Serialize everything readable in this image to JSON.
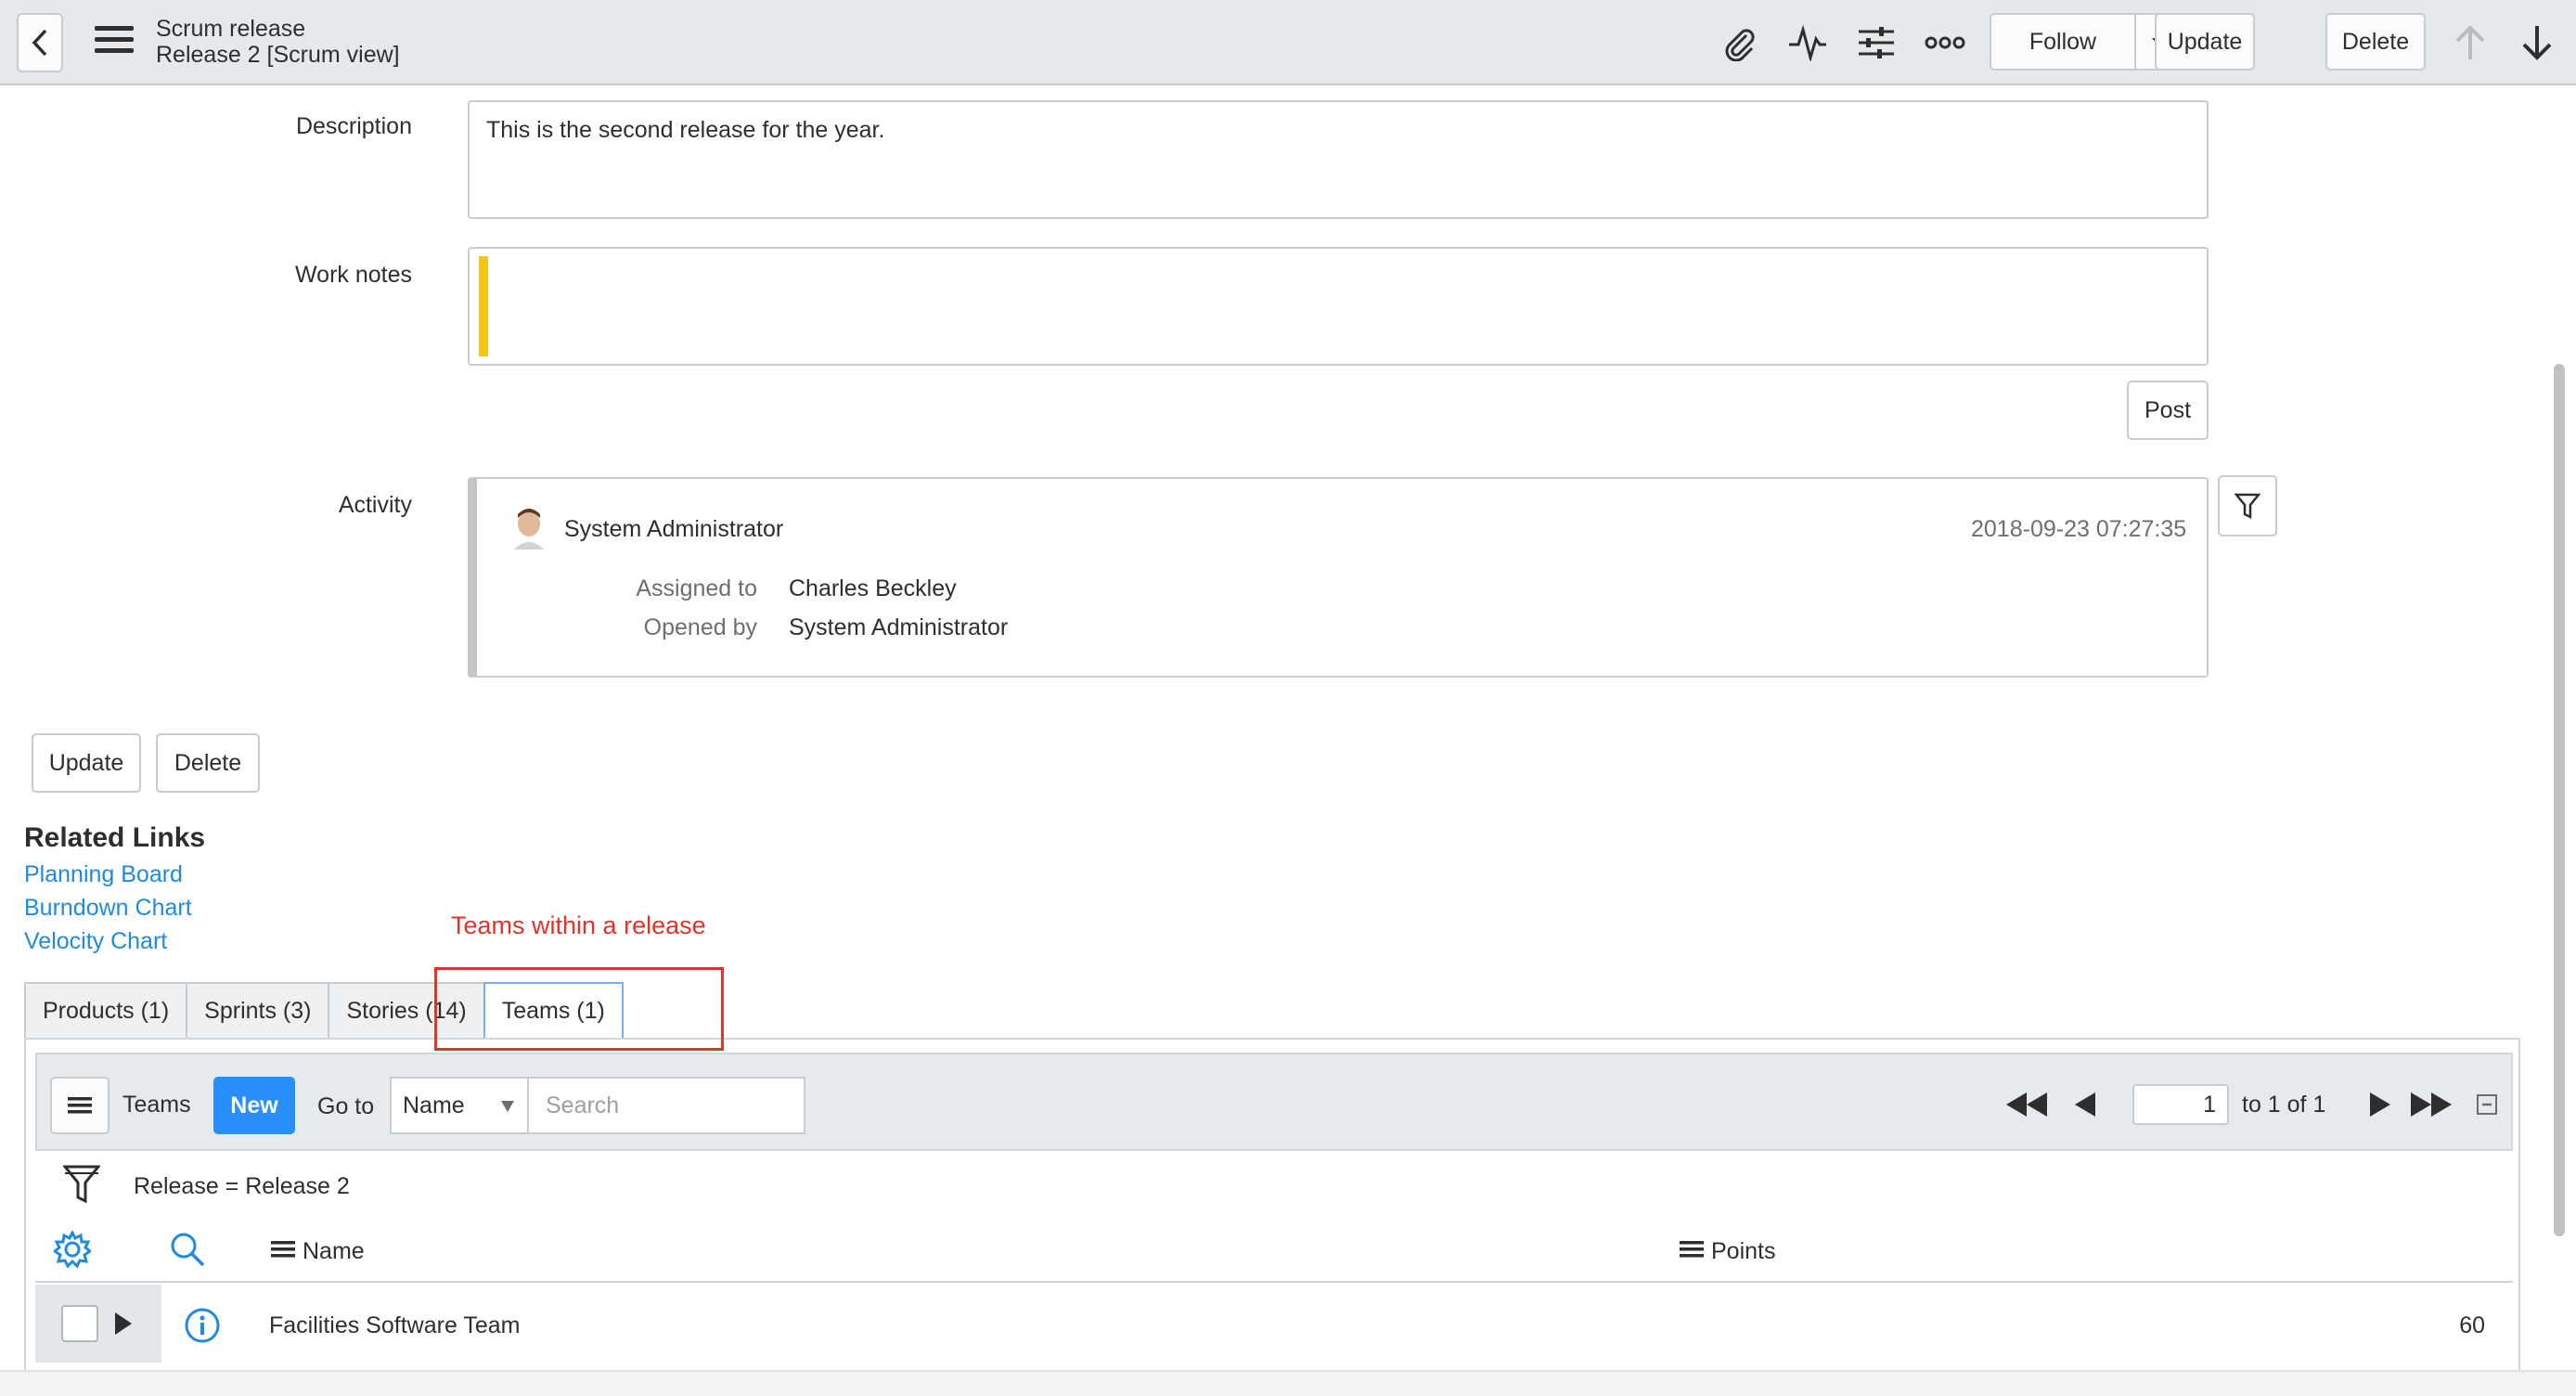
{
  "header": {
    "title": "Scrum release",
    "subtitle": "Release 2 [Scrum view]",
    "follow_label": "Follow",
    "update_label": "Update",
    "delete_label": "Delete"
  },
  "form": {
    "description_label": "Description",
    "description_value": "This is the second release for the year.",
    "work_notes_label": "Work notes",
    "post_label": "Post",
    "activity_label": "Activity"
  },
  "activity": {
    "user": "System Administrator",
    "timestamp": "2018-09-23 07:27:35",
    "fields": [
      {
        "label": "Assigned to",
        "value": "Charles Beckley"
      },
      {
        "label": "Opened by",
        "value": "System Administrator"
      }
    ]
  },
  "actions": {
    "update_label": "Update",
    "delete_label": "Delete"
  },
  "related_links": {
    "title": "Related Links",
    "links": [
      "Planning Board",
      "Burndown Chart",
      "Velocity Chart"
    ]
  },
  "annotation": "Teams within a release",
  "tabs": [
    "Products (1)",
    "Sprints (3)",
    "Stories (14)",
    "Teams (1)"
  ],
  "list": {
    "title": "Teams",
    "new_label": "New",
    "goto_label": "Go to",
    "goto_field": "Name",
    "search_placeholder": "Search",
    "page_value": "1",
    "page_summary": "to 1 of 1",
    "filter_text": "Release = Release 2",
    "columns": [
      "Name",
      "Points"
    ],
    "rows": [
      {
        "name": "Facilities Software Team",
        "points": "60"
      }
    ]
  },
  "colors": {
    "accent": "#278efc",
    "link": "#1f8ae0",
    "annotation": "#e0342a",
    "work_notes_bar": "#f5c518"
  }
}
